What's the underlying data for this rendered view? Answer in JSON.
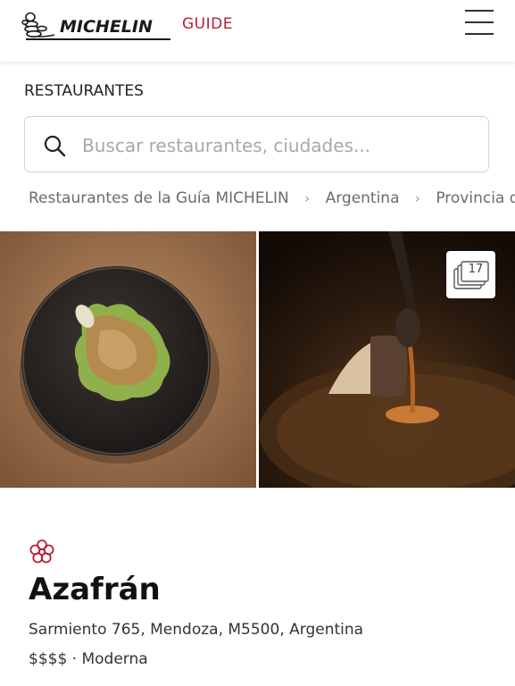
{
  "header": {
    "logo_text": "MICHELIN",
    "guide_label": "GUIDE",
    "brand_color": "#b71f35",
    "menu_icon": "hamburger-menu-icon"
  },
  "section": {
    "label": "RESTAURANTES"
  },
  "search": {
    "placeholder": "Buscar restaurantes, ciudades...",
    "value": "",
    "icon": "search-icon"
  },
  "breadcrumb": {
    "items": [
      "Restaurantes de la Guía MICHELIN",
      "Argentina",
      "Provincia de Mendoza"
    ],
    "separator": "›"
  },
  "gallery": {
    "photo_count": "17",
    "photos": [
      "dish-plate-photo",
      "dessert-spoon-photo"
    ]
  },
  "restaurant": {
    "distinction_icon": "michelin-star-icon",
    "name": "Azafrán",
    "address": "Sarmiento 765, Mendoza, M5500, Argentina",
    "price": "$$$$",
    "dot": "·",
    "cuisine": "Moderna"
  }
}
